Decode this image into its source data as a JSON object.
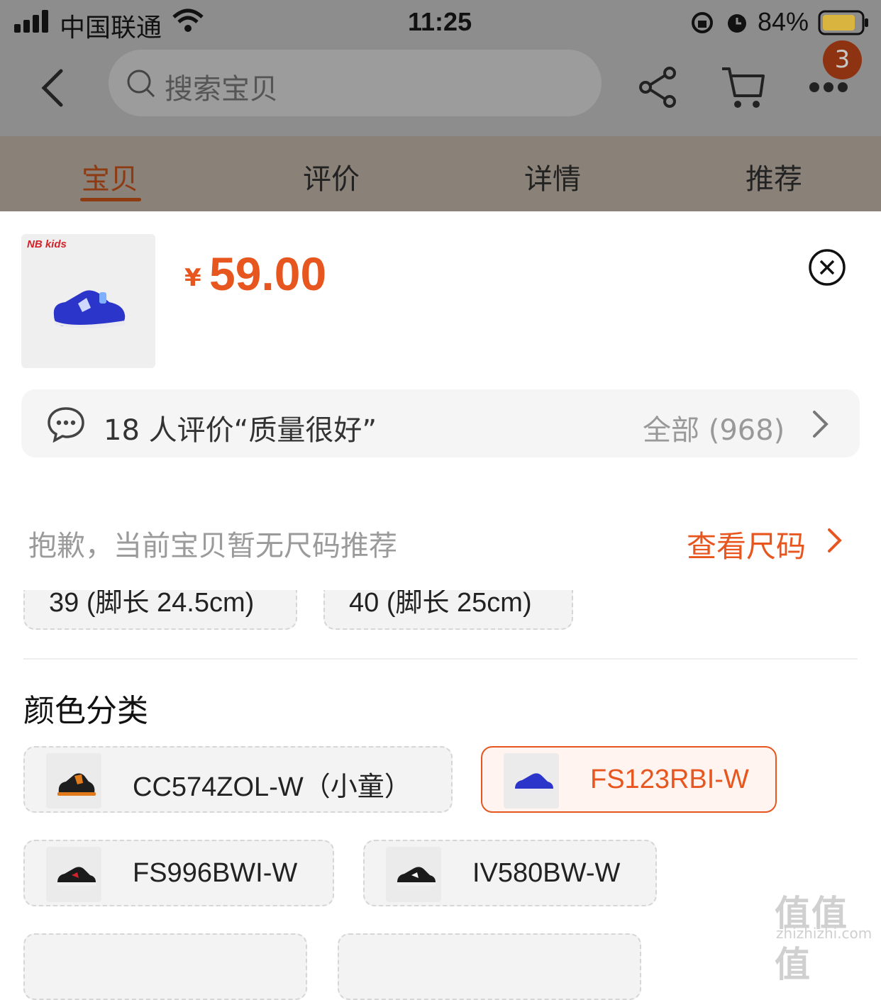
{
  "status_bar": {
    "carrier": "中国联通",
    "time": "11:25",
    "battery": "84%"
  },
  "nav": {
    "search_placeholder": "搜索宝贝",
    "cart_badge": "3"
  },
  "tabs": [
    {
      "label": "宝贝",
      "active": true
    },
    {
      "label": "评价",
      "active": false
    },
    {
      "label": "详情",
      "active": false
    },
    {
      "label": "推荐",
      "active": false
    }
  ],
  "product": {
    "brand_logo_text": "NB kids",
    "currency": "¥",
    "price": "59.00"
  },
  "review": {
    "summary": "18 人评价“质量很好”",
    "all": "全部 (968)"
  },
  "size": {
    "hint": "抱歉，当前宝贝暂无尺码推荐",
    "link": "查看尺码",
    "options": [
      "39 (脚长 24.5cm)",
      "40 (脚长 25cm)"
    ]
  },
  "color": {
    "title": "颜色分类",
    "options": [
      {
        "label": "CC574ZOL-W（小童）",
        "selected": false
      },
      {
        "label": "FS123RBI-W",
        "selected": true
      },
      {
        "label": "FS996BWI-W",
        "selected": false
      },
      {
        "label": "IV580BW-W",
        "selected": false
      }
    ]
  },
  "watermark": {
    "text": "值值值",
    "url": "zhizhizhi.com"
  },
  "colors": {
    "accent": "#e8561f",
    "dim_overlay": "#8d8d8d",
    "shoe_blue": "#2b35c9"
  }
}
